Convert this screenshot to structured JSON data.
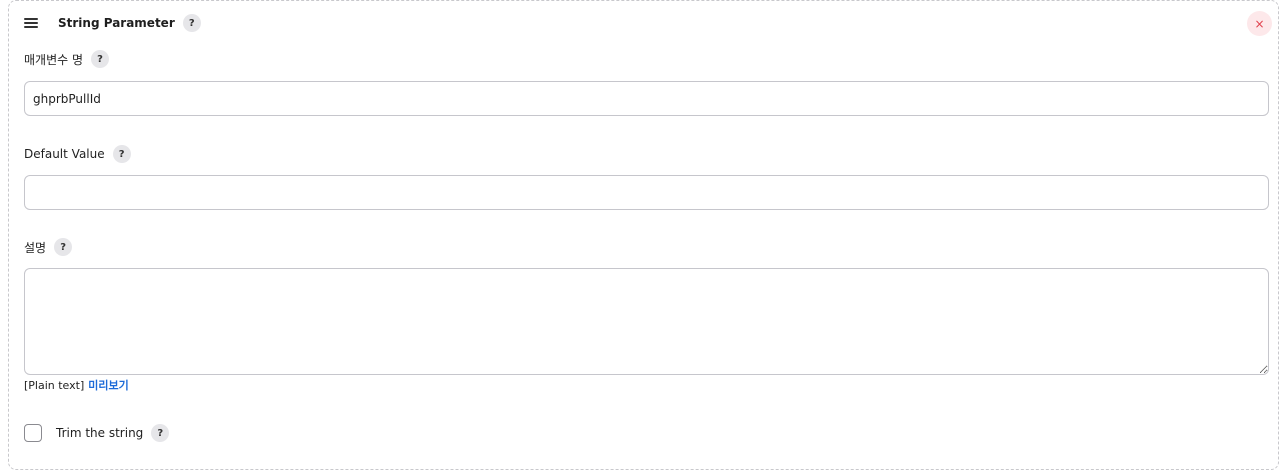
{
  "header": {
    "title": "String Parameter",
    "help": "?",
    "close": "×"
  },
  "fields": {
    "name": {
      "label": "매개변수 명",
      "value": "ghprbPullId"
    },
    "default_value": {
      "label": "Default Value",
      "value": ""
    },
    "description": {
      "label": "설명",
      "value": "",
      "format_note": "[Plain text]",
      "preview_link": "미리보기"
    }
  },
  "trim": {
    "label": "Trim the string",
    "checked": false
  },
  "help_glyph": "?",
  "colors": {
    "accent_link": "#1b6ad8",
    "close_red": "#e0404c",
    "close_bg": "#fde8ea",
    "help_bg": "#e6e6e9",
    "border": "#c6c6cc"
  },
  "icons": {
    "drag": "drag-handle-icon",
    "help": "help-icon",
    "close": "close-icon"
  }
}
